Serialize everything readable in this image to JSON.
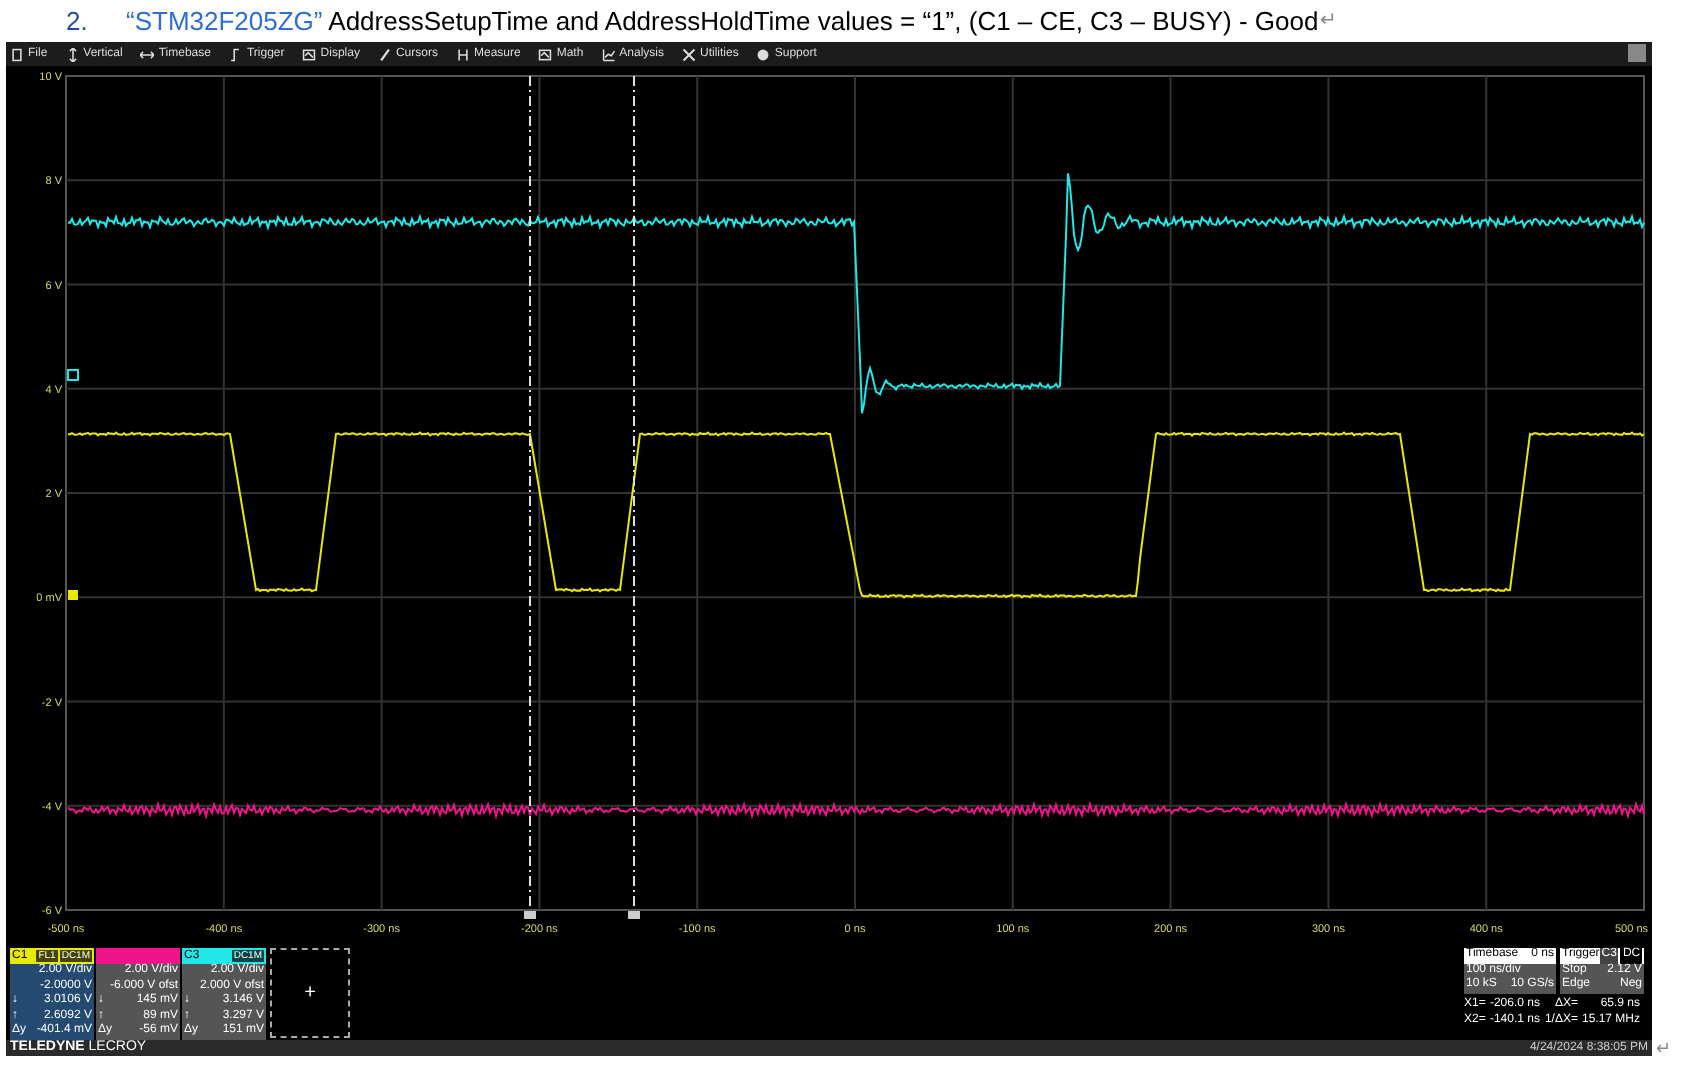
{
  "heading": {
    "number": "2.",
    "part_name": "“STM32F205ZG”",
    "text": " AddressSetupTime and AddressHoldTime values = “1”, (C1 – CE, C3 – BUSY) - Good",
    "mark": "↵"
  },
  "menu": [
    {
      "label": "File",
      "kind": "file"
    },
    {
      "label": "Vertical",
      "kind": "vertical"
    },
    {
      "label": "Timebase",
      "kind": "horizontal"
    },
    {
      "label": "Trigger",
      "kind": "trigger"
    },
    {
      "label": "Display",
      "kind": "display"
    },
    {
      "label": "Cursors",
      "kind": "cursor"
    },
    {
      "label": "Measure",
      "kind": "measure"
    },
    {
      "label": "Math",
      "kind": "display"
    },
    {
      "label": "Analysis",
      "kind": "analysis"
    },
    {
      "label": "Utilities",
      "kind": "tools"
    },
    {
      "label": "Support",
      "kind": "info"
    }
  ],
  "plot": {
    "y_labels": [
      "10 V",
      "8 V",
      "6 V",
      "4 V",
      "2 V",
      "0 mV",
      "-2 V",
      "-4 V",
      "-6 V"
    ],
    "x_labels": [
      "-500 ns",
      "-400 ns",
      "-300 ns",
      "-200 ns",
      "-100 ns",
      "0 ns",
      "100 ns",
      "200 ns",
      "300 ns",
      "400 ns",
      "500 ns"
    ]
  },
  "channels": [
    {
      "label": "C1",
      "color": "#e8e800",
      "tags": [
        "FL1",
        "DC1M"
      ],
      "rows": [
        {
          "symbol": "",
          "value": "2.00 V/div"
        },
        {
          "symbol": "",
          "value": "-2.0000 V"
        },
        {
          "symbol": "↓",
          "value": "3.0106 V"
        },
        {
          "symbol": "↑",
          "value": "2.6092 V"
        },
        {
          "symbol": "Δy",
          "value": "-401.4 mV"
        }
      ]
    },
    {
      "color": "#f0148c",
      "rows": [
        {
          "symbol": "",
          "value": "2.00 V/div"
        },
        {
          "symbol": "",
          "value": "-6.000 V ofst"
        },
        {
          "symbol": "↓",
          "value": "145 mV"
        },
        {
          "symbol": "↑",
          "value": "89 mV"
        },
        {
          "symbol": "Δy",
          "value": "-56 mV"
        }
      ]
    },
    {
      "label": "C3",
      "color": "#20e8e8",
      "tags": [
        "DC1M"
      ],
      "rows": [
        {
          "symbol": "",
          "value": "2.00 V/div"
        },
        {
          "symbol": "",
          "value": "2.000 V ofst"
        },
        {
          "symbol": "↓",
          "value": "3.146 V"
        },
        {
          "symbol": "↑",
          "value": "3.297 V"
        },
        {
          "symbol": "Δy",
          "value": "151 mV"
        }
      ]
    }
  ],
  "add_channel": "+",
  "timebase": {
    "title": "Timebase",
    "delay": "0 ns",
    "scale": "100 ns/div",
    "samples": "10 kS",
    "rate": "10 GS/s"
  },
  "trigger": {
    "title": "Trigger",
    "source": "C3",
    "coupling": "DC",
    "mode": "Stop",
    "level": "2.12 V",
    "type": "Edge",
    "slope": "Neg"
  },
  "cursors": [
    {
      "label": "X1=",
      "value": "-206.0 ns",
      "delta_label": "ΔX=",
      "delta_value": "65.9 ns"
    },
    {
      "label": "X2=",
      "value": "-140.1 ns",
      "delta_label": "1/ΔX=",
      "delta_value": "15.17 MHz"
    }
  ],
  "footer": {
    "brand": "**TELEDYNE** LECROY",
    "date": "4/24/2024 8:38:05 PM",
    "mark": "↵"
  }
}
